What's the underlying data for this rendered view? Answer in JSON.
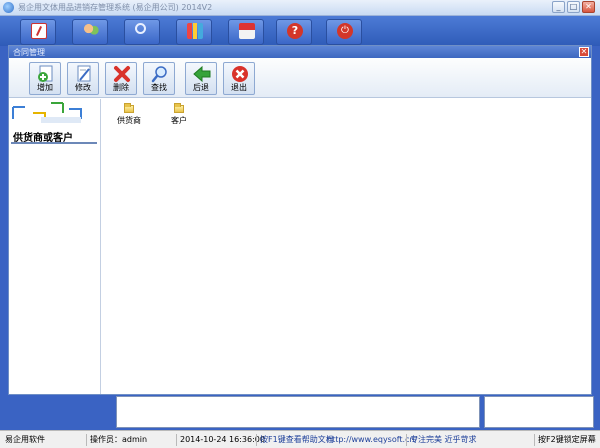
{
  "window": {
    "title": "易企用文体用品进销存管理系统 (易企用公司) 2014V2",
    "minimize": "_",
    "maximize": "□",
    "close": "✕"
  },
  "main_toolbar": {
    "buttons": [
      {
        "icon": "document-icon"
      },
      {
        "icon": "users-icon"
      },
      {
        "icon": "magnifier-icon"
      },
      {
        "icon": "bar-chart-icon"
      },
      {
        "icon": "house-icon"
      },
      {
        "icon": "help-icon"
      },
      {
        "icon": "power-icon"
      }
    ]
  },
  "dialog": {
    "title": "合同管理",
    "close": "✕",
    "toolbar": {
      "add": "增加",
      "edit": "修改",
      "delete": "删除",
      "search": "查找",
      "back": "后退",
      "exit": "退出"
    },
    "tree_title": "供货商或客户",
    "folders": [
      "供货商",
      "客户"
    ]
  },
  "statusbar": {
    "app": "易企用软件",
    "operator": "操作员：admin",
    "datetime": "2014-10-24 16:36:00",
    "help": "按F1键查看帮助文档",
    "website": "http://www.eqysoft.cn/",
    "slogan": "专注完美 近乎苛求",
    "lock": "按F2键锁定屏幕"
  },
  "colors": {
    "desktop": "#3a63c3",
    "dialog_title": "#4a73c9",
    "close_red": "#d84b3a"
  }
}
